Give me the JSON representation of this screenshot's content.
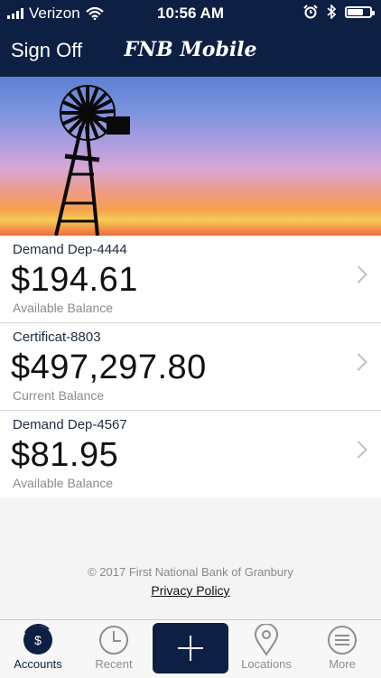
{
  "status_bar": {
    "carrier": "Verizon",
    "time": "10:56 AM",
    "icons": [
      "signal-icon",
      "wifi-icon",
      "alarm-icon",
      "bluetooth-icon",
      "battery-icon"
    ]
  },
  "header": {
    "sign_off": "Sign Off",
    "title": "FNB Mobile"
  },
  "hero": {
    "icon": "windmill-icon"
  },
  "accounts": [
    {
      "name": "Demand Dep-4444",
      "amount": "$194.61",
      "balance_type": "Available Balance"
    },
    {
      "name": "Certificat-8803",
      "amount": "$497,297.80",
      "balance_type": "Current Balance"
    },
    {
      "name": "Demand Dep-4567",
      "amount": "$81.95",
      "balance_type": "Available Balance"
    }
  ],
  "footer": {
    "copyright": "© 2017 First National Bank of Granbury",
    "privacy": "Privacy Policy"
  },
  "tabs": [
    {
      "label": "Accounts",
      "icon": "dollar-icon",
      "active": true
    },
    {
      "label": "Recent",
      "icon": "clock-icon",
      "active": false
    },
    {
      "label": "",
      "icon": "plus-icon",
      "active": false
    },
    {
      "label": "Locations",
      "icon": "location-pin-icon",
      "active": false
    },
    {
      "label": "More",
      "icon": "menu-icon",
      "active": false
    }
  ],
  "colors": {
    "primary": "#0e1f44",
    "muted": "#8e8e8e"
  }
}
